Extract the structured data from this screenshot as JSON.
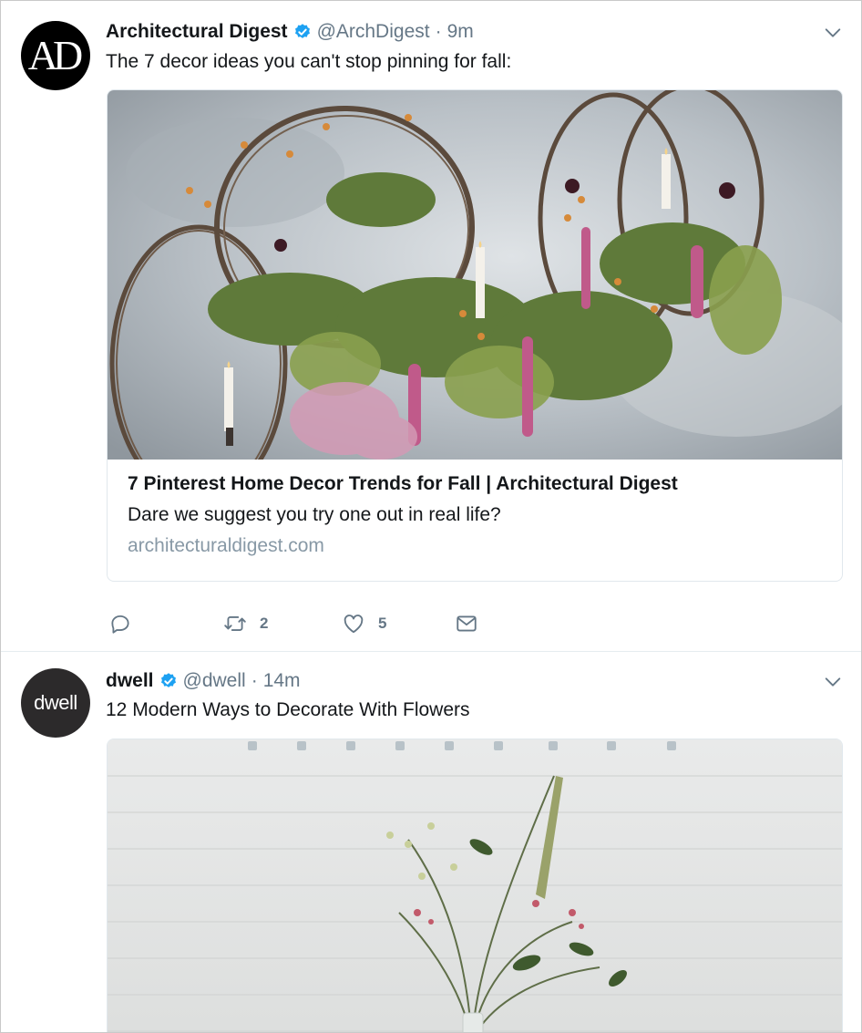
{
  "colors": {
    "verified": "#1da1f2",
    "text": "#14171a",
    "secondary": "#657786",
    "domain": "#8899a6"
  },
  "tweets": [
    {
      "avatar_text": "AD",
      "name": "Architectural Digest",
      "handle": "@ArchDigest",
      "separator": "·",
      "time": "9m",
      "text": "The 7 decor ideas you can't stop pinning for fall:",
      "card": {
        "title": "7 Pinterest Home Decor Trends for Fall | Architectural Digest",
        "description": "Dare we suggest you try one out in real life?",
        "domain": "architecturaldigest.com"
      },
      "actions": {
        "reply_icon": "reply-icon",
        "retweet_icon": "retweet-icon",
        "retweet_count": "2",
        "like_icon": "heart-icon",
        "like_count": "5",
        "dm_icon": "envelope-icon"
      }
    },
    {
      "avatar_text": "dwell",
      "name": "dwell",
      "handle": "@dwell",
      "separator": "·",
      "time": "14m",
      "text": "12 Modern Ways to Decorate With Flowers"
    }
  ]
}
